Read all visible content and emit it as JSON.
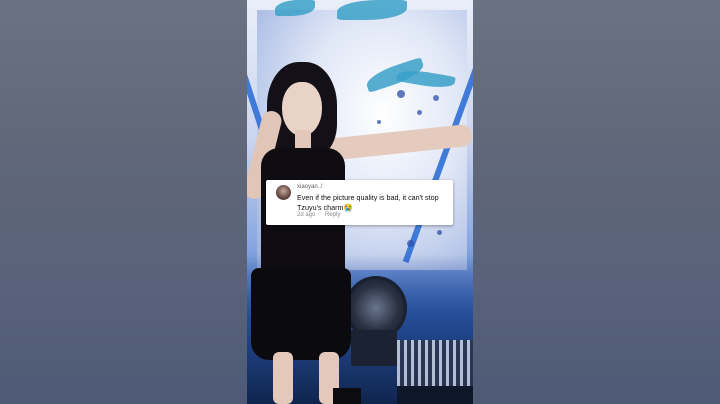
{
  "comment": {
    "username": "xiaoyan..!",
    "text": "Even if the picture quality is bad, it can't stop Tzuyu's charm😭",
    "time": "2d ago",
    "reply_label": "Reply"
  }
}
